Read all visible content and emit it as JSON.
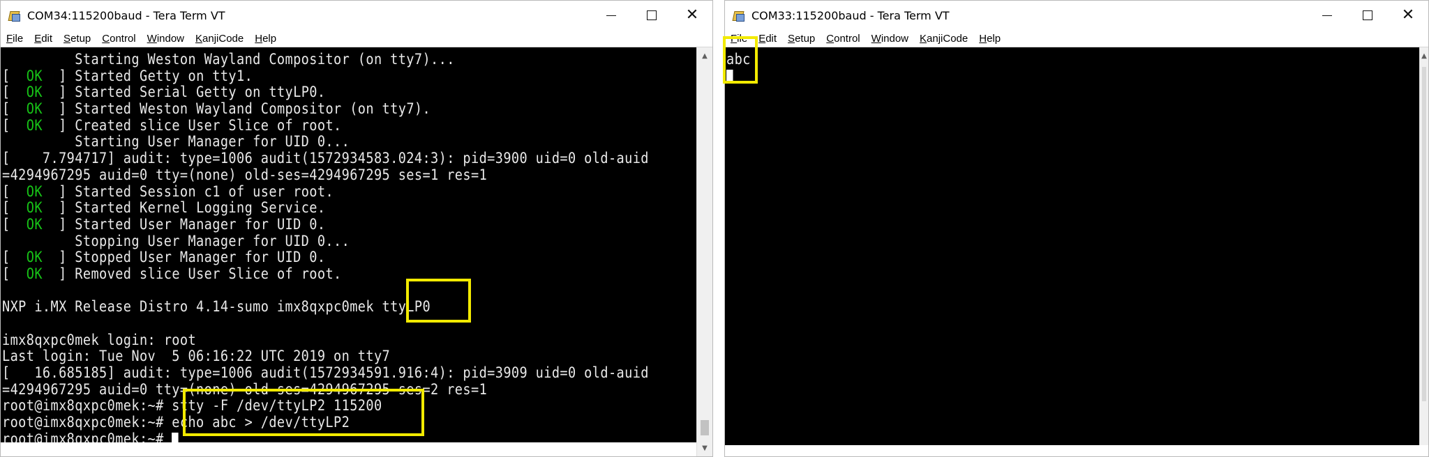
{
  "left_window": {
    "title": "COM34:115200baud - Tera Term VT",
    "menu": [
      "File",
      "Edit",
      "Setup",
      "Control",
      "Window",
      "KanjiCode",
      "Help"
    ],
    "menu_mnemonics": [
      "F",
      "E",
      "S",
      "C",
      "W",
      "K",
      "H"
    ],
    "terminal_lines": [
      {
        "ok": "",
        "text": "         Starting Weston Wayland Compositor (on tty7)..."
      },
      {
        "ok": "OK",
        "text": " ] Started Getty on tty1."
      },
      {
        "ok": "OK",
        "text": " ] Started Serial Getty on ttyLP0."
      },
      {
        "ok": "OK",
        "text": " ] Started Weston Wayland Compositor (on tty7)."
      },
      {
        "ok": "OK",
        "text": " ] Created slice User Slice of root."
      },
      {
        "ok": "",
        "text": "         Starting User Manager for UID 0..."
      },
      {
        "ok": "",
        "text": "[    7.794717] audit: type=1006 audit(1572934583.024:3): pid=3900 uid=0 old-auid"
      },
      {
        "ok": "",
        "text": "=4294967295 auid=0 tty=(none) old-ses=4294967295 ses=1 res=1"
      },
      {
        "ok": "OK",
        "text": " ] Started Session c1 of user root."
      },
      {
        "ok": "OK",
        "text": " ] Started Kernel Logging Service."
      },
      {
        "ok": "OK",
        "text": " ] Started User Manager for UID 0."
      },
      {
        "ok": "",
        "text": "         Stopping User Manager for UID 0..."
      },
      {
        "ok": "OK",
        "text": " ] Stopped User Manager for UID 0."
      },
      {
        "ok": "OK",
        "text": " ] Removed slice User Slice of root."
      },
      {
        "ok": "",
        "text": ""
      },
      {
        "ok": "",
        "text": "NXP i.MX Release Distro 4.14-sumo imx8qxpc0mek ttyLP0"
      },
      {
        "ok": "",
        "text": ""
      },
      {
        "ok": "",
        "text": "imx8qxpc0mek login: root"
      },
      {
        "ok": "",
        "text": "Last login: Tue Nov  5 06:16:22 UTC 2019 on tty7"
      },
      {
        "ok": "",
        "text": "[   16.685185] audit: type=1006 audit(1572934591.916:4): pid=3909 uid=0 old-auid"
      },
      {
        "ok": "",
        "text": "=4294967295 auid=0 tty=(none) old-ses=4294967295 ses=2 res=1"
      },
      {
        "ok": "",
        "text": "root@imx8qxpc0mek:~# stty -F /dev/ttyLP2 115200"
      },
      {
        "ok": "",
        "text": "root@imx8qxpc0mek:~# echo abc > /dev/ttyLP2"
      },
      {
        "ok": "",
        "text": "root@imx8qxpc0mek:~# ",
        "cursor": true
      }
    ]
  },
  "right_window": {
    "title": "COM33:115200baud - Tera Term VT",
    "menu": [
      "File",
      "Edit",
      "Setup",
      "Control",
      "Window",
      "KanjiCode",
      "Help"
    ],
    "menu_mnemonics": [
      "F",
      "E",
      "S",
      "C",
      "W",
      "K",
      "H"
    ],
    "terminal_lines": [
      {
        "ok": "",
        "text": "abc"
      },
      {
        "ok": "",
        "text": "",
        "cursor": true
      }
    ]
  },
  "icons": {
    "app": "tera-term-icon",
    "minimize": "minimize-icon",
    "maximize": "maximize-icon",
    "close": "close-icon"
  },
  "colors": {
    "terminal_bg": "#000000",
    "terminal_fg": "#e9e9e9",
    "ok_green": "#17c317",
    "highlight": "#f2ea00"
  }
}
